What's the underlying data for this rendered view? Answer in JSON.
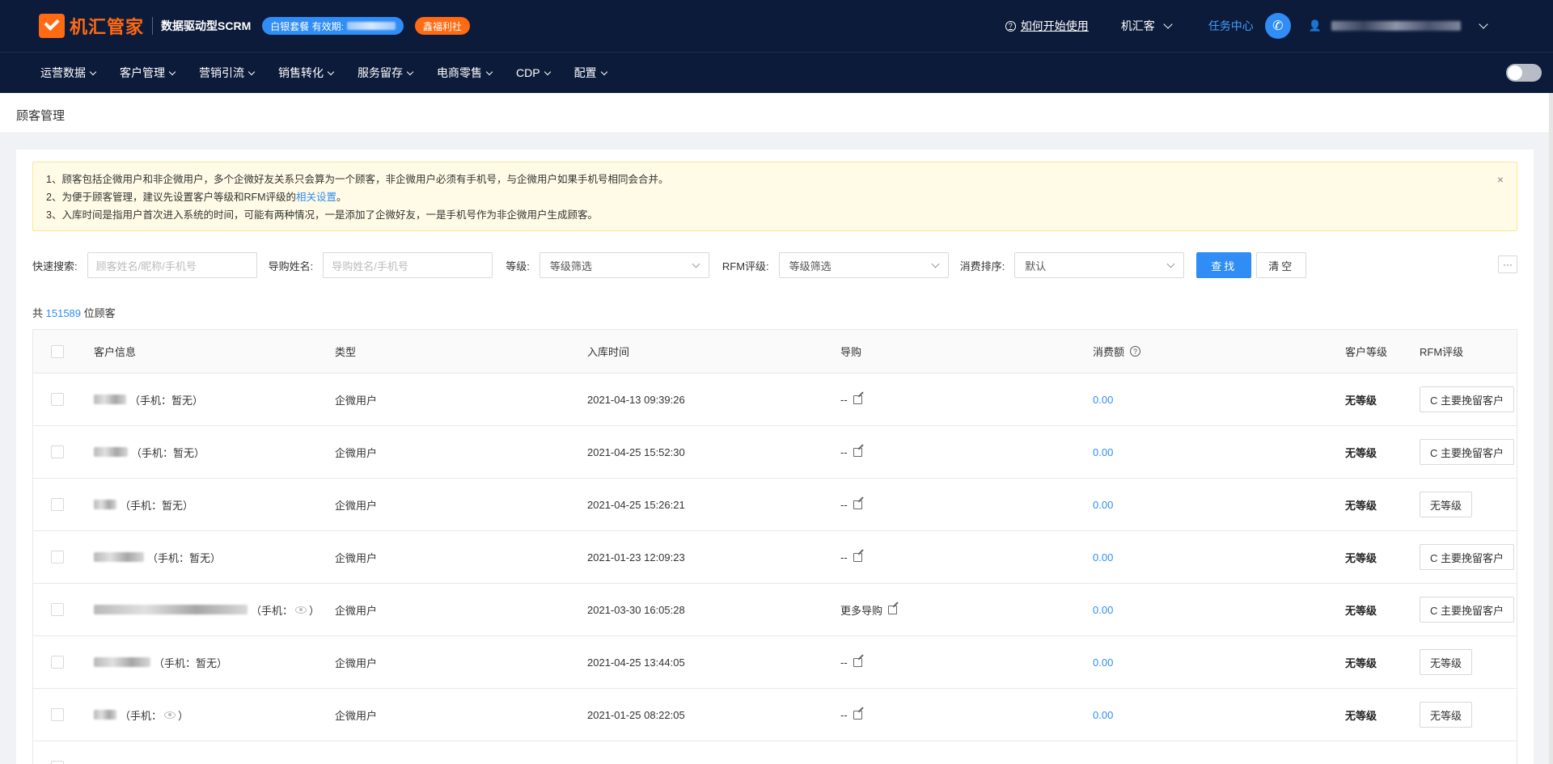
{
  "header": {
    "logo_text": "机汇管家",
    "product": "数据驱动型SCRM",
    "package_label": "白银套餐 有效期:",
    "welfare_label": "鑫福利社",
    "help_link": "如何开始使用",
    "org_name": "机汇客",
    "task_center": "任务中心"
  },
  "nav": {
    "items": [
      {
        "label": "运营数据"
      },
      {
        "label": "客户管理"
      },
      {
        "label": "营销引流"
      },
      {
        "label": "销售转化"
      },
      {
        "label": "服务留存"
      },
      {
        "label": "电商零售"
      },
      {
        "label": "CDP"
      },
      {
        "label": "配置"
      }
    ]
  },
  "page": {
    "title": "顾客管理"
  },
  "notice": {
    "line1": "1、顾客包括企微用户和非企微用户，多个企微好友关系只会算为一个顾客，非企微用户必须有手机号，与企微用户如果手机号相同会合并。",
    "line2_prefix": "2、为便于顾客管理，建议先设置客户等级和RFM评级的",
    "line2_link": "相关设置",
    "line2_suffix": "。",
    "line3": "3、入库时间是指用户首次进入系统的时间，可能有两种情况，一是添加了企微好友，一是手机号作为非企微用户生成顾客。",
    "close": "×"
  },
  "filters": {
    "quick_label": "快速搜索:",
    "quick_placeholder": "顾客姓名/昵称/手机号",
    "guide_label": "导购姓名:",
    "guide_placeholder": "导购姓名/手机号",
    "level_label": "等级:",
    "level_value": "等级筛选",
    "rfm_label": "RFM评级:",
    "rfm_value": "等级筛选",
    "sort_label": "消费排序:",
    "sort_value": "默认",
    "search_btn": "查找",
    "clear_btn": "清空",
    "more": "···"
  },
  "summary": {
    "prefix": "共",
    "count": "151589",
    "suffix": "位顾客"
  },
  "table": {
    "headers": {
      "info": "客户信息",
      "type": "类型",
      "time": "入库时间",
      "guide": "导购",
      "spend": "消费额",
      "level": "客户等级",
      "rfm": "RFM评级"
    },
    "rows": [
      {
        "phone": "（手机：暂无）",
        "type": "企微用户",
        "time": "2021-04-13 09:39:26",
        "guide": "--",
        "spend": "0.00",
        "level": "无等级",
        "rfm": "C 主要挽留客户"
      },
      {
        "phone": "（手机：暂无）",
        "type": "企微用户",
        "time": "2021-04-25 15:52:30",
        "guide": "--",
        "spend": "0.00",
        "level": "无等级",
        "rfm": "C 主要挽留客户"
      },
      {
        "phone": "（手机：暂无）",
        "type": "企微用户",
        "time": "2021-04-25 15:26:21",
        "guide": "--",
        "spend": "0.00",
        "level": "无等级",
        "rfm": "无等级"
      },
      {
        "phone": "（手机：暂无）",
        "type": "企微用户",
        "time": "2021-01-23 12:09:23",
        "guide": "--",
        "spend": "0.00",
        "level": "无等级",
        "rfm": "C 主要挽留客户"
      },
      {
        "phone": "（手机：",
        "phone_end": "）",
        "type": "企微用户",
        "time": "2021-03-30 16:05:28",
        "guide": "更多导购",
        "spend": "0.00",
        "level": "无等级",
        "rfm": "C 主要挽留客户"
      },
      {
        "phone": "（手机：暂无）",
        "type": "企微用户",
        "time": "2021-04-25 13:44:05",
        "guide": "--",
        "spend": "0.00",
        "level": "无等级",
        "rfm": "无等级"
      },
      {
        "phone": "（手机：",
        "phone_end": "）",
        "type": "企微用户",
        "time": "2021-01-25 08:22:05",
        "guide": "--",
        "spend": "0.00",
        "level": "无等级",
        "rfm": "无等级"
      }
    ]
  },
  "colors": {
    "header_bg": "#0d1b3a",
    "accent": "#2f8df5",
    "brand": "#ff6a13"
  }
}
